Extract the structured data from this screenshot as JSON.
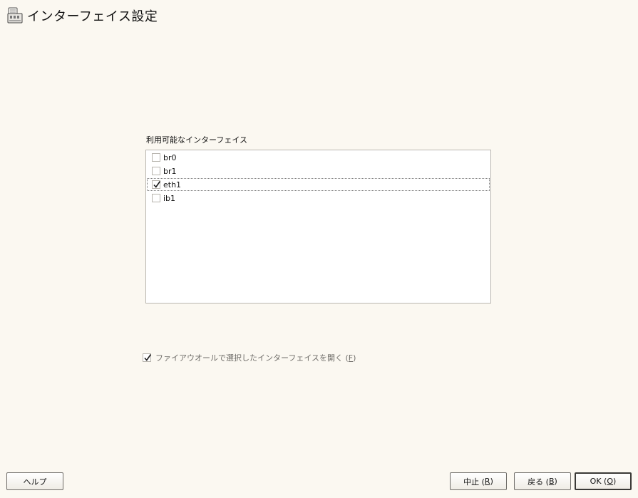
{
  "window": {
    "title": "インターフェイス設定",
    "icon": "network-card-icon"
  },
  "interfaces": {
    "label": "利用可能なインターフェイス",
    "items": [
      {
        "name": "br0",
        "checked": false
      },
      {
        "name": "br1",
        "checked": false
      },
      {
        "name": "eth1",
        "checked": true,
        "focused": true
      },
      {
        "name": "ib1",
        "checked": false
      }
    ]
  },
  "firewall_option": {
    "label_prefix": "ファイアウオールで選択したインターフェイスを開く (",
    "mnemonic": "F",
    "label_suffix": ")",
    "checked": true
  },
  "buttons": {
    "help": {
      "label": "ヘルプ"
    },
    "abort": {
      "prefix": "中止 (",
      "mnemonic": "R",
      "suffix": ")"
    },
    "back": {
      "prefix": "戻る (",
      "mnemonic": "B",
      "suffix": ")"
    },
    "ok": {
      "prefix": "OK (",
      "mnemonic": "O",
      "suffix": ")"
    }
  }
}
